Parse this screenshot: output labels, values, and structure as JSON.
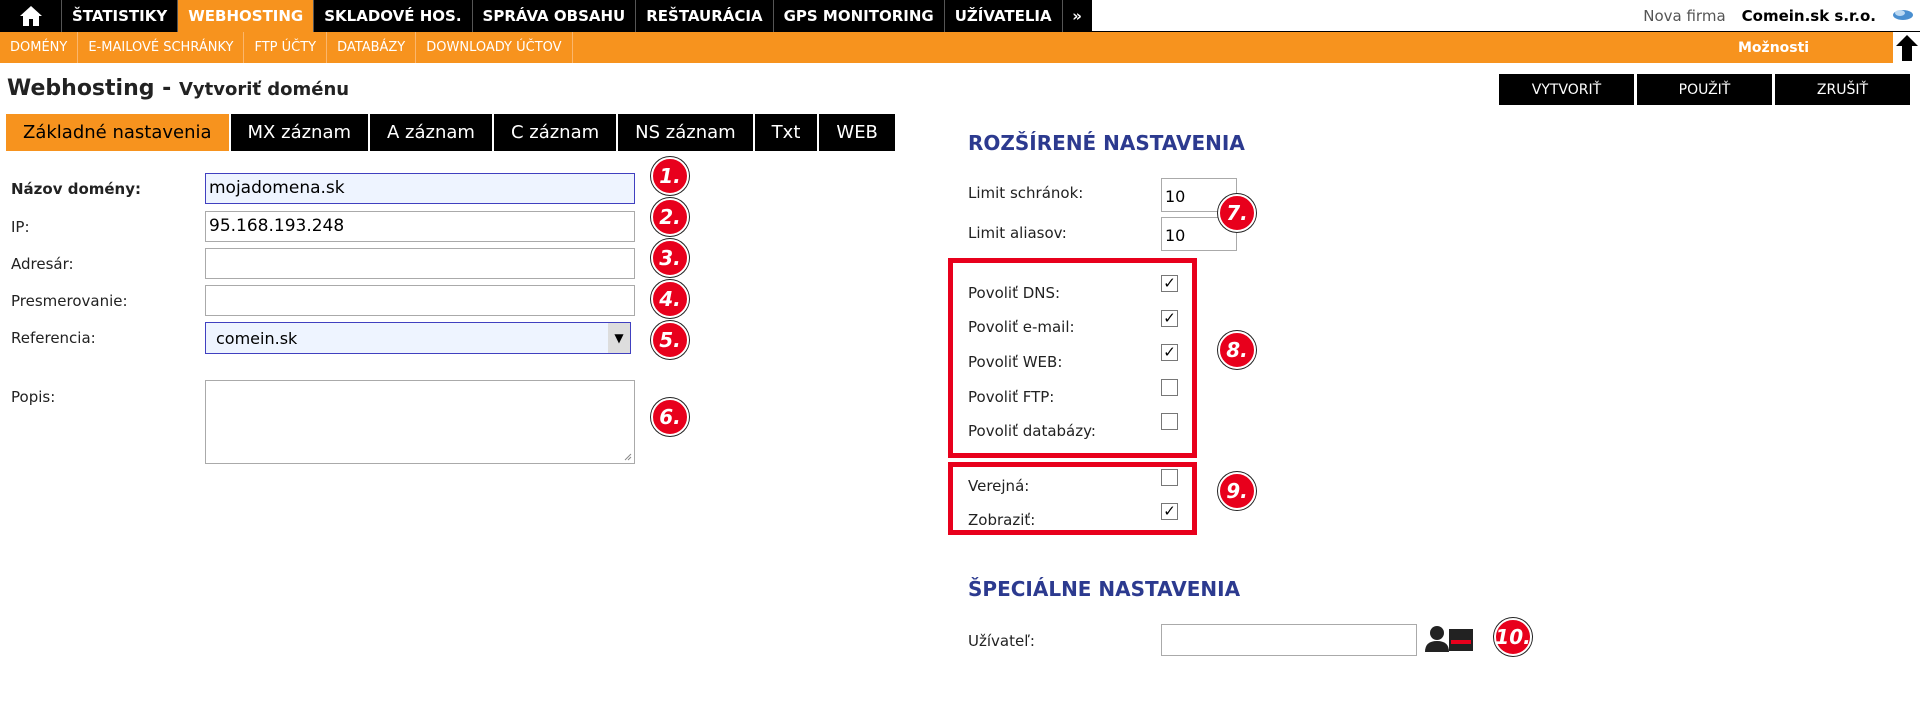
{
  "topnav": {
    "items": [
      "ŠTATISTIKY",
      "WEBHOSTING",
      "SKLADOVÉ HOS.",
      "SPRÁVA OBSAHU",
      "REŠTAURÁCIA",
      "GPS MONITORING",
      "UŽÍVATELIA",
      "»"
    ],
    "firm_label": "Nova firma",
    "firm_name": "Comein.sk s.r.o."
  },
  "subnav": {
    "items": [
      "DOMÉNY",
      "E-MAILOVÉ SCHRÁNKY",
      "FTP ÚČTY",
      "DATABÁZY",
      "DOWNLOADY ÚČTOV"
    ],
    "options": "Možnosti"
  },
  "page": {
    "title": "Webhosting -",
    "subtitle": "Vytvoriť doménu"
  },
  "actions": [
    "VYTVORIŤ",
    "POUŽIŤ",
    "ZRUŠIŤ"
  ],
  "tabs": [
    "Základné nastavenia",
    "MX záznam",
    "A záznam",
    "C záznam",
    "NS záznam",
    "Txt",
    "WEB"
  ],
  "form": {
    "domain_label": "Názov domény:",
    "domain_value": "mojadomena.sk",
    "ip_label": "IP:",
    "ip_value": "95.168.193.248",
    "dir_label": "Adresár:",
    "dir_value": "",
    "redirect_label": "Presmerovanie:",
    "redirect_value": "",
    "ref_label": "Referencia:",
    "ref_value": "comein.sk",
    "desc_label": "Popis:"
  },
  "advanced": {
    "title": "ROZŠÍRENÉ NASTAVENIA",
    "limit_mailbox_label": "Limit schránok:",
    "limit_mailbox_value": "10",
    "limit_alias_label": "Limit aliasov:",
    "limit_alias_value": "10",
    "checks": [
      {
        "label": "Povoliť DNS:",
        "checked": true
      },
      {
        "label": "Povoliť e-mail:",
        "checked": true
      },
      {
        "label": "Povoliť WEB:",
        "checked": true
      },
      {
        "label": "Povoliť FTP:",
        "checked": false
      },
      {
        "label": "Povoliť databázy:",
        "checked": false
      }
    ],
    "public_label": "Verejná:",
    "public_checked": false,
    "show_label": "Zobraziť:",
    "show_checked": true
  },
  "special": {
    "title": "ŠPECIÁLNE NASTAVENIA",
    "user_label": "Užívateľ:",
    "user_value": ""
  },
  "badges": [
    "1.",
    "2.",
    "3.",
    "4.",
    "5.",
    "6.",
    "7.",
    "8.",
    "9.",
    "10."
  ],
  "colors": {
    "orange": "#f7931e",
    "black": "#000000",
    "title_blue": "#2c3a8f",
    "badge_red": "#e8001c"
  }
}
